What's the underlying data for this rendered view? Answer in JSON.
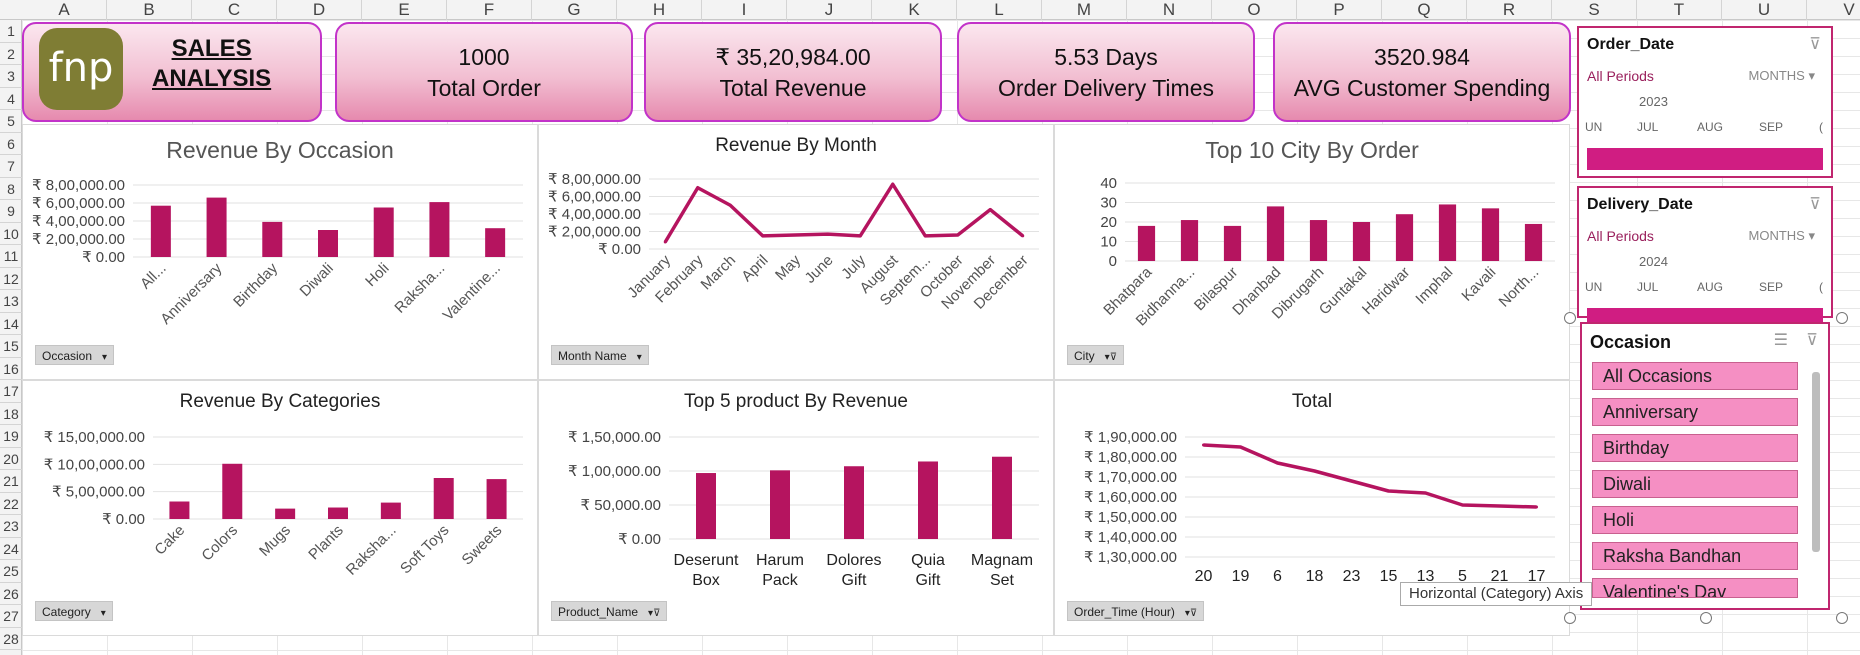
{
  "columns": [
    "A",
    "B",
    "C",
    "D",
    "E",
    "F",
    "G",
    "H",
    "I",
    "J",
    "K",
    "L",
    "M",
    "N",
    "O",
    "P",
    "Q",
    "R",
    "S",
    "T",
    "U",
    "V"
  ],
  "rows": [
    "1",
    "2",
    "3",
    "4",
    "5",
    "6",
    "7",
    "8",
    "9",
    "10",
    "11",
    "12",
    "13",
    "14",
    "15",
    "16",
    "17",
    "18",
    "19",
    "20",
    "21",
    "22",
    "23",
    "24",
    "25",
    "26",
    "27",
    "28"
  ],
  "header": {
    "logo_text": "fnp",
    "title_line1": "SALES",
    "title_line2": "ANALYSIS"
  },
  "kpis": [
    {
      "value": "1000",
      "label": "Total Order"
    },
    {
      "value": "₹ 35,20,984.00",
      "label": "Total Revenue"
    },
    {
      "value": "5.53 Days",
      "label": "Order Delivery Times"
    },
    {
      "value": "3520.984",
      "label": "AVG Customer Spending"
    }
  ],
  "chart_data": [
    {
      "type": "bar",
      "title": "Revenue By Occasion",
      "categories": [
        "All...",
        "Anniversary",
        "Birthday",
        "Diwali",
        "Holi",
        "Raksha...",
        "Valentine..."
      ],
      "values": [
        570000,
        660000,
        390000,
        300000,
        550000,
        610000,
        320000
      ],
      "yticks": [
        "₹ 8,00,000.00",
        "₹ 6,00,000.00",
        "₹ 4,00,000.00",
        "₹ 2,00,000.00",
        "₹ 0.00"
      ],
      "ylim": [
        0,
        800000
      ],
      "field_button": "Occasion"
    },
    {
      "type": "line",
      "title": "Revenue By Month",
      "categories": [
        "January",
        "February",
        "March",
        "April",
        "May",
        "June",
        "July",
        "August",
        "Septem...",
        "October",
        "November",
        "December"
      ],
      "values": [
        80000,
        700000,
        500000,
        150000,
        160000,
        170000,
        150000,
        740000,
        150000,
        160000,
        450000,
        150000
      ],
      "yticks": [
        "₹ 8,00,000.00",
        "₹ 6,00,000.00",
        "₹ 4,00,000.00",
        "₹ 2,00,000.00",
        "₹ 0.00"
      ],
      "ylim": [
        0,
        800000
      ],
      "field_button": "Month Name"
    },
    {
      "type": "bar",
      "title": "Top 10 City By Order",
      "categories": [
        "Bhatpara",
        "Bidhanna...",
        "Bilaspur",
        "Dhanbad",
        "Dibrugarh",
        "Guntakal",
        "Haridwar",
        "Imphal",
        "Kavali",
        "North..."
      ],
      "values": [
        18,
        21,
        18,
        28,
        21,
        20,
        24,
        29,
        27,
        19
      ],
      "yticks": [
        "40",
        "30",
        "20",
        "10",
        "0"
      ],
      "ylim": [
        0,
        40
      ],
      "field_button": "City"
    },
    {
      "type": "bar",
      "title": "Revenue By Categories",
      "categories": [
        "Cake",
        "Colors",
        "Mugs",
        "Plants",
        "Raksha...",
        "Soft Toys",
        "Sweets"
      ],
      "values": [
        320000,
        1010000,
        190000,
        210000,
        300000,
        750000,
        730000
      ],
      "yticks": [
        "₹ 15,00,000.00",
        "₹ 10,00,000.00",
        "₹ 5,00,000.00",
        "₹ 0.00"
      ],
      "ylim": [
        0,
        1500000
      ],
      "field_button": "Category"
    },
    {
      "type": "bar",
      "title": "Top 5 product By Revenue",
      "categories": [
        "Deserunt Box",
        "Harum Pack",
        "Dolores Gift",
        "Quia Gift",
        "Magnam Set"
      ],
      "values": [
        97000,
        101000,
        107000,
        114000,
        121000
      ],
      "yticks": [
        "₹ 1,50,000.00",
        "₹ 1,00,000.00",
        "₹ 50,000.00",
        "₹ 0.00"
      ],
      "ylim": [
        0,
        150000
      ],
      "field_button": "Product_Name"
    },
    {
      "type": "line",
      "title": "Total",
      "categories": [
        "20",
        "19",
        "6",
        "18",
        "23",
        "15",
        "13",
        "5",
        "21",
        "17"
      ],
      "values": [
        1860000,
        1850000,
        1770000,
        1730000,
        1680000,
        1630000,
        1620000,
        1560000,
        1555000,
        1550000
      ],
      "yticks": [
        "₹ 1,90,000.00",
        "₹ 1,80,000.00",
        "₹ 1,70,000.00",
        "₹ 1,60,000.00",
        "₹ 1,50,000.00",
        "₹ 1,40,000.00",
        "₹ 1,30,000.00"
      ],
      "ylim": [
        1300000,
        1900000
      ],
      "field_button": "Order_Time (Hour)"
    }
  ],
  "slicers": {
    "order_date": {
      "title": "Order_Date",
      "periods": "All Periods",
      "level": "MONTHS",
      "year": "2023",
      "months": [
        "UN",
        "JUL",
        "AUG",
        "SEP",
        "("
      ]
    },
    "delivery_date": {
      "title": "Delivery_Date",
      "periods": "All Periods",
      "level": "MONTHS",
      "year": "2024",
      "months": [
        "UN",
        "JUL",
        "AUG",
        "SEP",
        "("
      ]
    },
    "occasion": {
      "title": "Occasion",
      "items": [
        "All Occasions",
        "Anniversary",
        "Birthday",
        "Diwali",
        "Holi",
        "Raksha Bandhan",
        "Valentine's Day"
      ]
    }
  },
  "tooltip": "Horizontal (Category) Axis",
  "colors": {
    "accent": "#b5145f",
    "card_border": "#c233c9",
    "slicer_item": "#f58fc3"
  }
}
